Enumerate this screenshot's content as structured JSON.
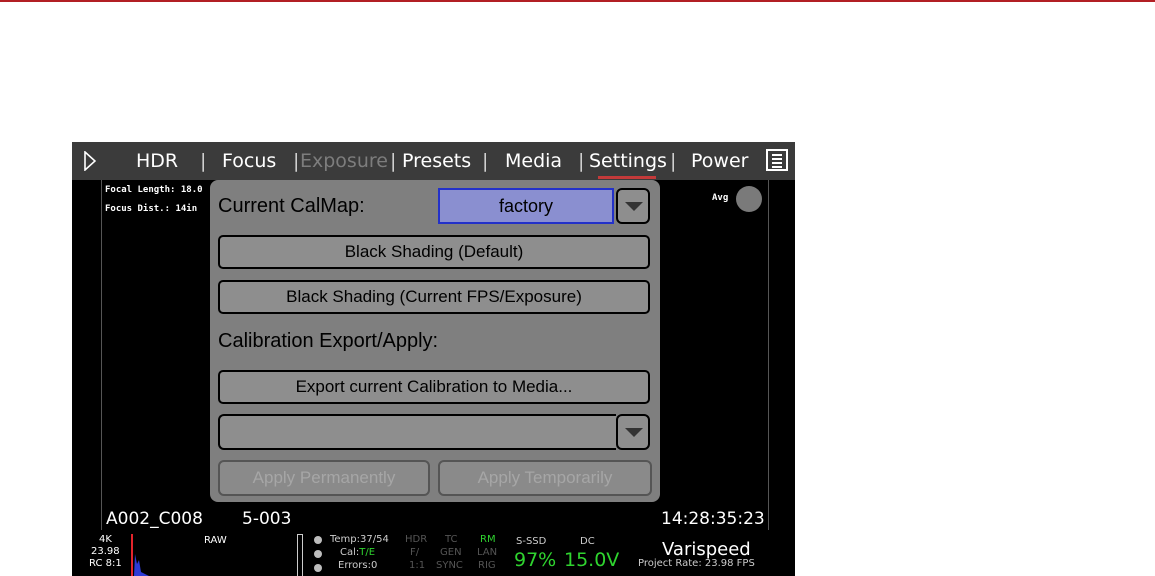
{
  "topbar": {
    "tabs": [
      {
        "label": "HDR"
      },
      {
        "label": "Focus"
      },
      {
        "label": "Exposure"
      },
      {
        "label": "Presets"
      },
      {
        "label": "Media"
      },
      {
        "label": "Settings"
      },
      {
        "label": "Power"
      }
    ],
    "active_tab": "Settings",
    "disabled_tab": "Exposure"
  },
  "overlay": {
    "focal_length": "Focal Length: 18.0",
    "focus_dist": "Focus Dist.: 14in",
    "avg_label": "Avg"
  },
  "panel": {
    "current_calmap_label": "Current CalMap:",
    "calmap_value": "factory",
    "black_shading_default": "Black Shading (Default)",
    "black_shading_current": "Black Shading (Current FPS/Exposure)",
    "calibration_export_label": "Calibration Export/Apply:",
    "export_button": "Export current Calibration to Media...",
    "export_select_value": "",
    "apply_permanently": "Apply Permanently",
    "apply_temporarily": "Apply Temporarily"
  },
  "clip": {
    "name": "A002_C008",
    "reel": "5-003",
    "timecode": "14:28:35:23"
  },
  "status": {
    "resolution": "4K",
    "fps": "23.98",
    "compression": "RC 8:1",
    "format": "RAW",
    "temp": "Temp:37/54",
    "cal_prefix": "Cal:",
    "cal_value": "T/E",
    "errors": "Errors:0",
    "hdr": "HDR",
    "f_slash": "F/",
    "ratio": "1:1",
    "tc": "TC",
    "gen": "GEN",
    "sync": "SYNC",
    "rm": "RM",
    "lan": "LAN",
    "rig": "RIG",
    "media_label": "S-SSD",
    "media_value": "97%",
    "power_label": "DC",
    "power_value": "15.0V",
    "varispeed": "Varispeed",
    "project_rate": "Project Rate: 23.98 FPS"
  },
  "colors": {
    "accent_rule": "#b21f24",
    "selected_select": "#8a8fd0",
    "status_green": "#2fd42f"
  },
  "icons": [
    "play-icon",
    "menu-icon",
    "dropdown-arrow-icon",
    "avg-indicator-icon",
    "status-dot-icon"
  ]
}
